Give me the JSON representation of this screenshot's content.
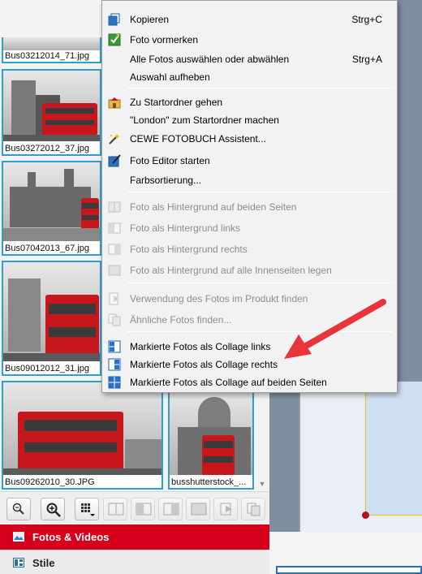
{
  "photo_panel": {
    "thumbnails": [
      {
        "caption": "Bus03212014_71.jpg"
      },
      {
        "caption": "Bus03272012_37.jpg"
      },
      {
        "caption": "Bus07042013_67.jpg"
      },
      {
        "caption": "Bus09012012_31.jpg"
      },
      {
        "caption": "Bus09262010_30.JPG"
      },
      {
        "caption": "busshutterstock_..."
      }
    ]
  },
  "context_menu": {
    "items": [
      {
        "label": "Kopieren",
        "shortcut": "Strg+C",
        "icon": "copy-icon",
        "enabled": true
      },
      {
        "label": "Foto vormerken",
        "shortcut": "",
        "icon": "bookmark-check-icon",
        "enabled": true
      },
      {
        "label": "Alle Fotos auswählen oder abwählen",
        "shortcut": "Strg+A",
        "icon": "",
        "enabled": true
      },
      {
        "label": "Auswahl aufheben",
        "shortcut": "",
        "icon": "",
        "enabled": true
      },
      {
        "label": "Zu Startordner gehen",
        "shortcut": "",
        "icon": "home-folder-icon",
        "enabled": true
      },
      {
        "label": "\"London\" zum Startordner machen",
        "shortcut": "",
        "icon": "",
        "enabled": true
      },
      {
        "label": "CEWE FOTOBUCH Assistent...",
        "shortcut": "",
        "icon": "magic-wand-icon",
        "enabled": true
      },
      {
        "label": "Foto Editor starten",
        "shortcut": "",
        "icon": "photo-editor-icon",
        "enabled": true
      },
      {
        "label": "Farbsortierung...",
        "shortcut": "",
        "icon": "",
        "enabled": true
      },
      {
        "label": "Foto als Hintergrund auf beiden Seiten",
        "shortcut": "",
        "icon": "background-both-icon",
        "enabled": false
      },
      {
        "label": "Foto als Hintergrund links",
        "shortcut": "",
        "icon": "background-left-icon",
        "enabled": false
      },
      {
        "label": "Foto als Hintergrund rechts",
        "shortcut": "",
        "icon": "background-right-icon",
        "enabled": false
      },
      {
        "label": "Foto als Hintergrund auf alle Innenseiten legen",
        "shortcut": "",
        "icon": "background-all-icon",
        "enabled": false
      },
      {
        "label": "Verwendung des Fotos im Produkt finden",
        "shortcut": "",
        "icon": "find-usage-icon",
        "enabled": false
      },
      {
        "label": "Ähnliche Fotos finden...",
        "shortcut": "",
        "icon": "similar-photos-icon",
        "enabled": false
      },
      {
        "label": "Markierte Fotos als Collage links",
        "shortcut": "",
        "icon": "collage-left-icon",
        "enabled": true
      },
      {
        "label": "Markierte Fotos als Collage rechts",
        "shortcut": "",
        "icon": "collage-right-icon",
        "enabled": true
      },
      {
        "label": "Markierte Fotos als Collage auf beiden Seiten",
        "shortcut": "",
        "icon": "collage-both-icon",
        "enabled": true
      }
    ]
  },
  "toolbar": {
    "buttons": [
      {
        "icon": "zoom-out-icon",
        "enabled": true
      },
      {
        "icon": "zoom-in-icon",
        "enabled": true
      },
      {
        "icon": "grid-view-dropdown-icon",
        "enabled": true
      },
      {
        "icon": "background-both-icon",
        "enabled": false
      },
      {
        "icon": "background-left-icon",
        "enabled": false
      },
      {
        "icon": "background-right-icon",
        "enabled": false
      },
      {
        "icon": "background-all-icon",
        "enabled": false
      },
      {
        "icon": "find-usage-icon",
        "enabled": false
      },
      {
        "icon": "similar-photos-icon",
        "enabled": false
      },
      {
        "icon": "collage-icon",
        "enabled": false
      }
    ]
  },
  "nav": {
    "fotos_label": "Fotos & Videos",
    "stile_label": "Stile"
  },
  "colors": {
    "accent_red": "#d5001c",
    "selection_blue": "#2e9fd6",
    "annotation_arrow": "#e8343a"
  }
}
